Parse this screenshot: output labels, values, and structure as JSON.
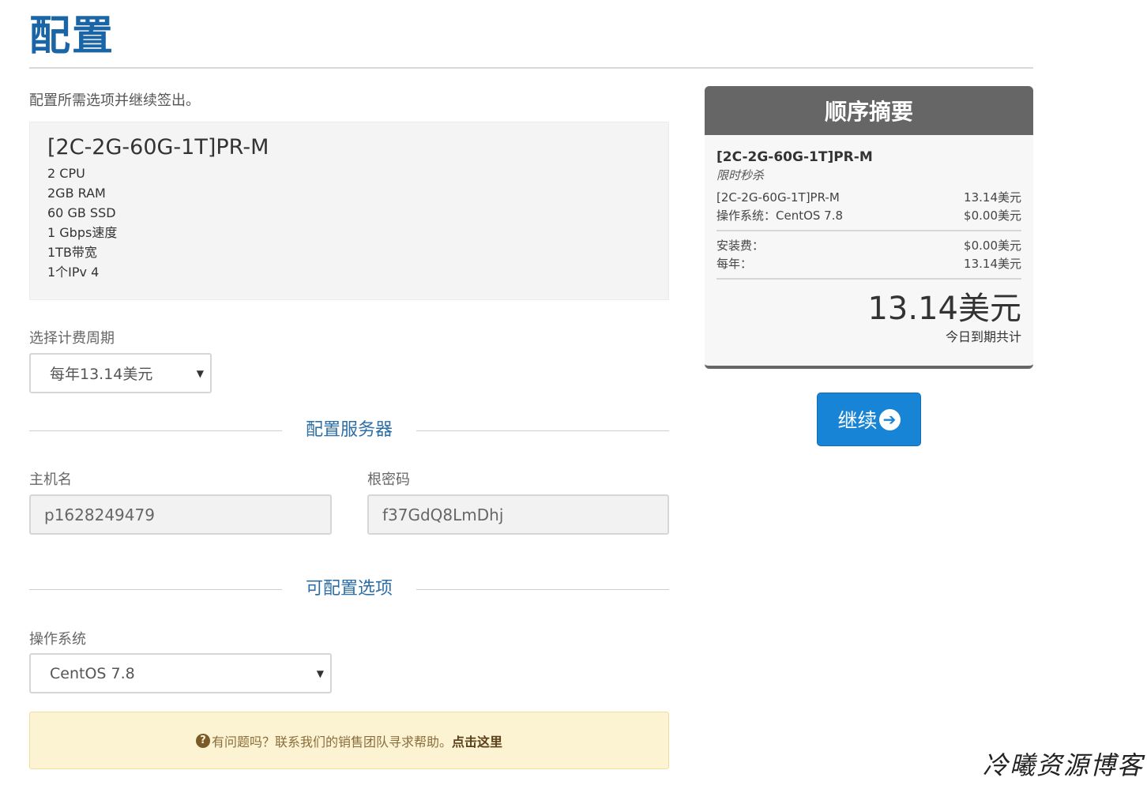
{
  "page": {
    "title": "配置",
    "intro": "配置所需选项并继续签出。"
  },
  "product": {
    "name": "[2C-2G-60G-1T]PR-M",
    "features": [
      "2 CPU",
      "2GB RAM",
      "60 GB SSD",
      "1 Gbps速度",
      "1TB带宽",
      "1个IPv 4"
    ]
  },
  "billing": {
    "label": "选择计费周期",
    "selected": "每年13.14美元"
  },
  "server_section": {
    "title": "配置服务器",
    "hostname_label": "主机名",
    "hostname_value": "p1628249479",
    "password_label": "根密码",
    "password_value": "f37GdQ8LmDhj"
  },
  "options_section": {
    "title": "可配置选项",
    "os_label": "操作系统",
    "os_selected": "CentOS 7.8"
  },
  "help": {
    "icon": "question-circle-icon",
    "text": "有问题吗？联系我们的销售团队寻求帮助。",
    "link": "点击这里"
  },
  "summary": {
    "title": "顺序摘要",
    "product_name": "[2C-2G-60G-1T]PR-M",
    "product_group": "限时秒杀",
    "lines": [
      {
        "label": "[2C-2G-60G-1T]PR-M",
        "value": "13.14美元"
      },
      {
        "label": "操作系统：CentOS 7.8",
        "value": "$0.00美元"
      }
    ],
    "fees": [
      {
        "label": "安装费：",
        "value": "$0.00美元"
      },
      {
        "label": "每年：",
        "value": "13.14美元"
      }
    ],
    "total": "13.14美元",
    "total_label": "今日到期共计"
  },
  "continue": {
    "label": "继续",
    "icon": "arrow-circle-right-icon"
  },
  "watermark": "冷曦资源博客",
  "colors": {
    "brand": "#1a65a6",
    "button": "#1784d6",
    "summary_header": "#666666",
    "help_bg": "#fcf3d3"
  }
}
